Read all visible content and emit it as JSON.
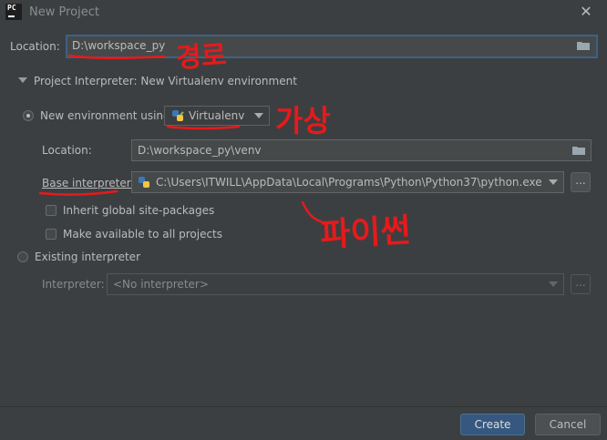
{
  "window": {
    "app_icon_text": "PC",
    "title": "New Project"
  },
  "location": {
    "label": "Location:",
    "value": "D:\\workspace_py"
  },
  "interpreter_section": {
    "header": "Project Interpreter: New Virtualenv environment"
  },
  "new_env": {
    "radio_label": "New environment using",
    "tool_selected": "Virtualenv",
    "location_label": "Location:",
    "location_value": "D:\\workspace_py\\venv",
    "base_label": "Base interpreter:",
    "base_value": "C:\\Users\\ITWILL\\AppData\\Local\\Programs\\Python\\Python37\\python.exe",
    "browse_label": "...",
    "inherit_label": "Inherit global site-packages",
    "make_available_label": "Make available to all projects"
  },
  "existing": {
    "radio_label": "Existing interpreter",
    "interpreter_label": "Interpreter:",
    "interpreter_value": "<No interpreter>",
    "browse_label": "..."
  },
  "footer": {
    "create_label": "Create",
    "cancel_label": "Cancel"
  },
  "annotations": {
    "ink_color": "#e8191b",
    "path_note": "경로",
    "virtual_note": "가상",
    "python_note": "파이썬"
  },
  "colors": {
    "background": "#3c3f41",
    "field": "#45494a",
    "focus_border": "#3d6185",
    "primary_button": "#365880"
  }
}
